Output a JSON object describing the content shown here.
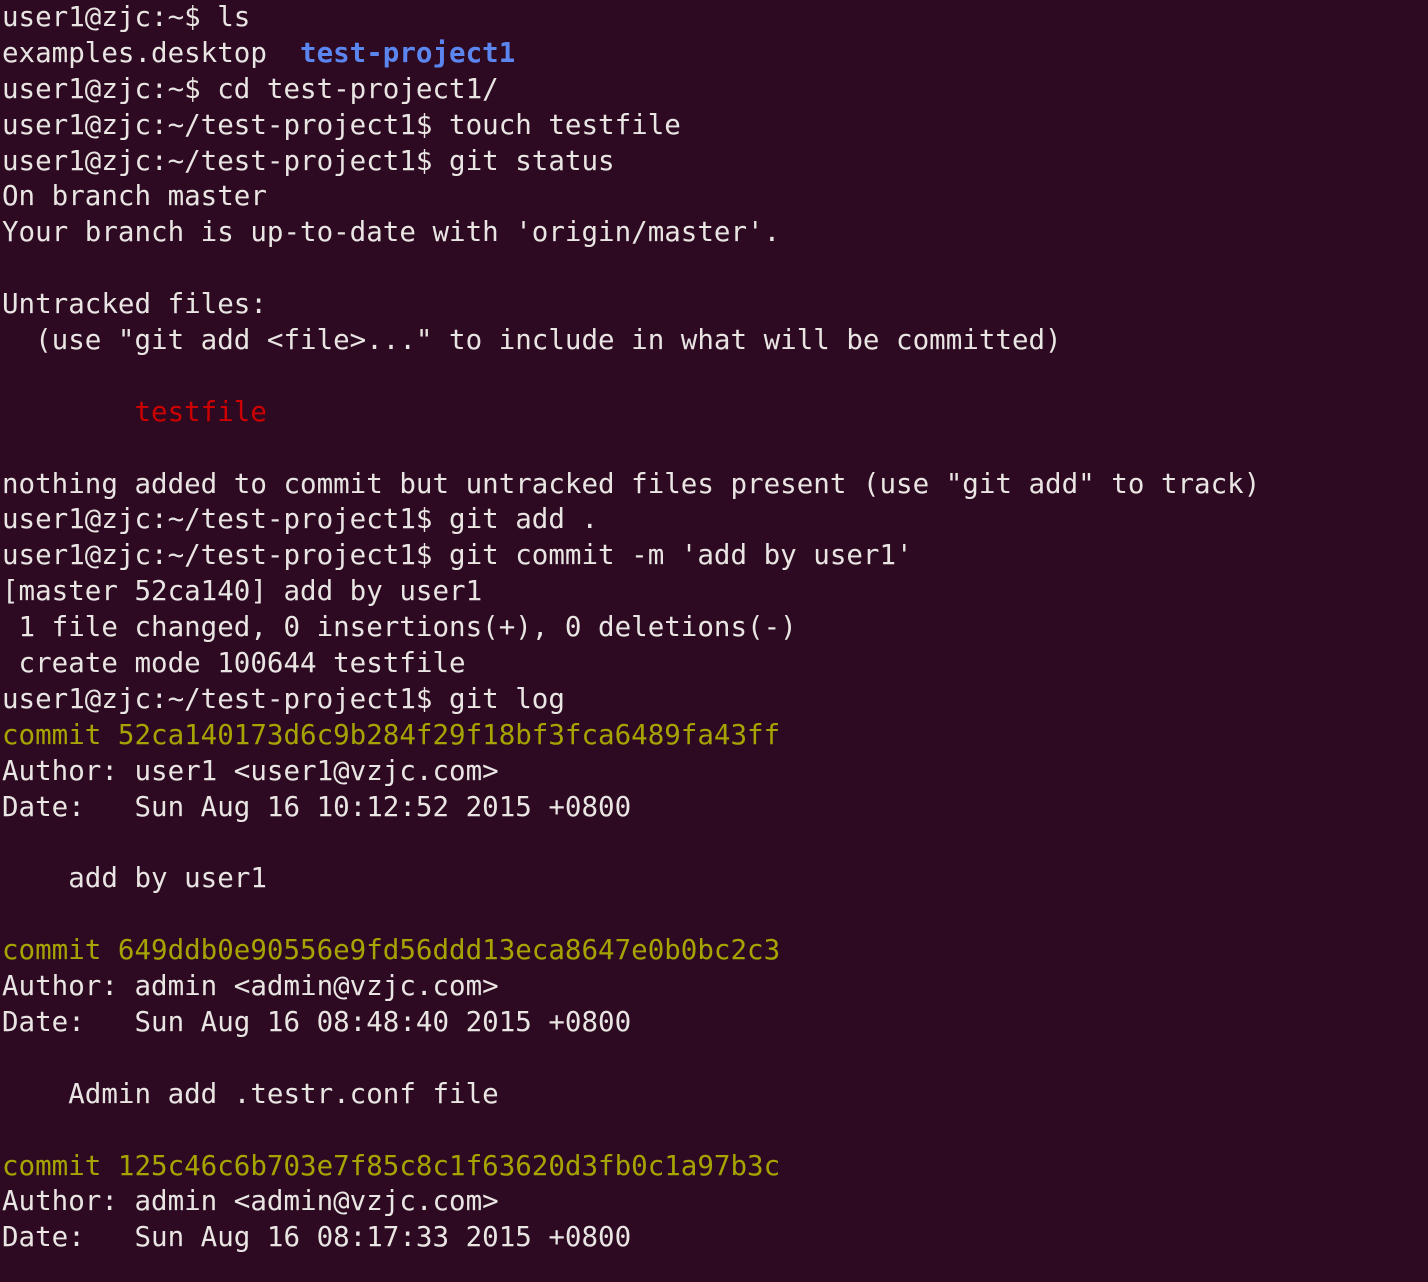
{
  "terminal": {
    "background_color": "#2d0a22",
    "default_text_color": "#e8e5e2",
    "directory_color": "#5c86ef",
    "untracked_file_color": "#cc0000",
    "commit_hash_color": "#a5a400",
    "prompt_home": "user1@zjc:~$",
    "prompt_project": "user1@zjc:~/test-project1$",
    "lines": [
      {
        "id": "l01",
        "segments": [
          {
            "text": "user1@zjc:~$ ls",
            "color": "default"
          }
        ]
      },
      {
        "id": "l02",
        "segments": [
          {
            "text": "examples.desktop  ",
            "color": "default"
          },
          {
            "text": "test-project1",
            "color": "dir"
          }
        ]
      },
      {
        "id": "l03",
        "segments": [
          {
            "text": "user1@zjc:~$ cd test-project1/",
            "color": "default"
          }
        ]
      },
      {
        "id": "l04",
        "segments": [
          {
            "text": "user1@zjc:~/test-project1$ touch testfile",
            "color": "default"
          }
        ]
      },
      {
        "id": "l05",
        "segments": [
          {
            "text": "user1@zjc:~/test-project1$ git status",
            "color": "default"
          }
        ]
      },
      {
        "id": "l06",
        "segments": [
          {
            "text": "On branch master",
            "color": "default"
          }
        ]
      },
      {
        "id": "l07",
        "segments": [
          {
            "text": "Your branch is up-to-date with 'origin/master'.",
            "color": "default"
          }
        ]
      },
      {
        "id": "l08",
        "segments": [
          {
            "text": " ",
            "color": "blank"
          }
        ]
      },
      {
        "id": "l09",
        "segments": [
          {
            "text": "Untracked files:",
            "color": "default"
          }
        ]
      },
      {
        "id": "l10",
        "segments": [
          {
            "text": "  (use \"git add <file>...\" to include in what will be committed)",
            "color": "default"
          }
        ]
      },
      {
        "id": "l11",
        "segments": [
          {
            "text": " ",
            "color": "blank"
          }
        ]
      },
      {
        "id": "l12",
        "segments": [
          {
            "text": "        ",
            "color": "blank"
          },
          {
            "text": "testfile",
            "color": "red"
          }
        ]
      },
      {
        "id": "l13",
        "segments": [
          {
            "text": " ",
            "color": "blank"
          }
        ]
      },
      {
        "id": "l14",
        "segments": [
          {
            "text": "nothing added to commit but untracked files present (use \"git add\" to track)",
            "color": "default"
          }
        ]
      },
      {
        "id": "l15",
        "segments": [
          {
            "text": "user1@zjc:~/test-project1$ git add .",
            "color": "default"
          }
        ]
      },
      {
        "id": "l16",
        "segments": [
          {
            "text": "user1@zjc:~/test-project1$ git commit -m 'add by user1'",
            "color": "default"
          }
        ]
      },
      {
        "id": "l17",
        "segments": [
          {
            "text": "[master 52ca140] add by user1",
            "color": "default"
          }
        ]
      },
      {
        "id": "l18",
        "segments": [
          {
            "text": " 1 file changed, 0 insertions(+), 0 deletions(-)",
            "color": "default"
          }
        ]
      },
      {
        "id": "l19",
        "segments": [
          {
            "text": " create mode 100644 testfile",
            "color": "default"
          }
        ]
      },
      {
        "id": "l20",
        "segments": [
          {
            "text": "user1@zjc:~/test-project1$ git log",
            "color": "default"
          }
        ]
      },
      {
        "id": "l21",
        "segments": [
          {
            "text": "commit 52ca140173d6c9b284f29f18bf3fca6489fa43ff",
            "color": "yellow"
          }
        ]
      },
      {
        "id": "l22",
        "segments": [
          {
            "text": "Author: user1 <user1@vzjc.com>",
            "color": "default"
          }
        ]
      },
      {
        "id": "l23",
        "segments": [
          {
            "text": "Date:   Sun Aug 16 10:12:52 2015 +0800",
            "color": "default"
          }
        ]
      },
      {
        "id": "l24",
        "segments": [
          {
            "text": " ",
            "color": "blank"
          }
        ]
      },
      {
        "id": "l25",
        "segments": [
          {
            "text": "    add by user1",
            "color": "default"
          }
        ]
      },
      {
        "id": "l26",
        "segments": [
          {
            "text": " ",
            "color": "blank"
          }
        ]
      },
      {
        "id": "l27",
        "segments": [
          {
            "text": "commit 649ddb0e90556e9fd56ddd13eca8647e0b0bc2c3",
            "color": "yellow"
          }
        ]
      },
      {
        "id": "l28",
        "segments": [
          {
            "text": "Author: admin <admin@vzjc.com>",
            "color": "default"
          }
        ]
      },
      {
        "id": "l29",
        "segments": [
          {
            "text": "Date:   Sun Aug 16 08:48:40 2015 +0800",
            "color": "default"
          }
        ]
      },
      {
        "id": "l30",
        "segments": [
          {
            "text": " ",
            "color": "blank"
          }
        ]
      },
      {
        "id": "l31",
        "segments": [
          {
            "text": "    Admin add .testr.conf file",
            "color": "default"
          }
        ]
      },
      {
        "id": "l32",
        "segments": [
          {
            "text": " ",
            "color": "blank"
          }
        ]
      },
      {
        "id": "l33",
        "segments": [
          {
            "text": "commit 125c46c6b703e7f85c8c1f63620d3fb0c1a97b3c",
            "color": "yellow"
          }
        ]
      },
      {
        "id": "l34",
        "segments": [
          {
            "text": "Author: admin <admin@vzjc.com>",
            "color": "default"
          }
        ]
      },
      {
        "id": "l35",
        "segments": [
          {
            "text": "Date:   Sun Aug 16 08:17:33 2015 +0800",
            "color": "default"
          }
        ]
      }
    ]
  }
}
